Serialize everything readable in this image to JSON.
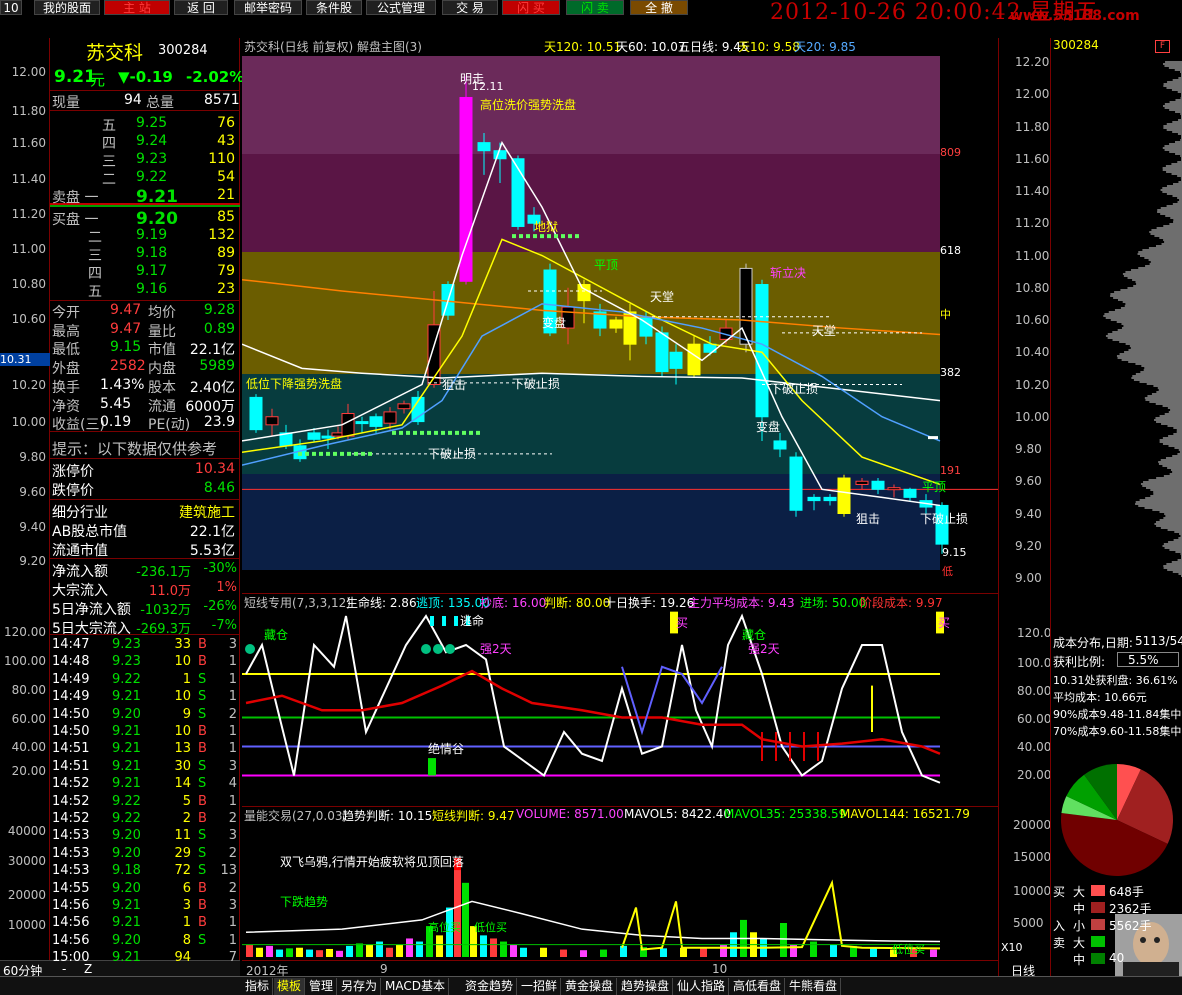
{
  "topbar": {
    "items": [
      "10",
      "我的股面",
      "主 站",
      "返 回",
      "邮举密码",
      "条件股",
      "公式管理",
      "交 易",
      "闪 买",
      "闪 卖",
      "全 撤"
    ],
    "clock": "2012-10-26 20:00:42 星期五",
    "watermark": "www.55188.com"
  },
  "stock": {
    "name": "苏交科",
    "code": "300284",
    "price": "9.21",
    "unit": "元",
    "change": "▼-0.19",
    "pct": "-2.02%"
  },
  "quote": {
    "now_vol_label": "现量",
    "now_vol": "94",
    "total_vol_label": "总量",
    "total_vol": "8571",
    "asks": [
      {
        "l": "五",
        "p": "9.25",
        "v": "76"
      },
      {
        "l": "四",
        "p": "9.24",
        "v": "43"
      },
      {
        "l": "三",
        "p": "9.23",
        "v": "110"
      },
      {
        "l": "二",
        "p": "9.22",
        "v": "54"
      },
      {
        "l": "卖盘 一",
        "p": "9.21",
        "v": "21"
      }
    ],
    "bids": [
      {
        "l": "买盘 一",
        "p": "9.20",
        "v": "85"
      },
      {
        "l": "二",
        "p": "9.19",
        "v": "132"
      },
      {
        "l": "三",
        "p": "9.18",
        "v": "89"
      },
      {
        "l": "四",
        "p": "9.17",
        "v": "79"
      },
      {
        "l": "五",
        "p": "9.16",
        "v": "23"
      }
    ],
    "stats": [
      [
        "今开",
        "9.47",
        "均价",
        "9.28"
      ],
      [
        "最高",
        "9.47",
        "量比",
        "0.89"
      ],
      [
        "最低",
        "9.15",
        "市值",
        "22.1亿"
      ],
      [
        "外盘",
        "2582",
        "内盘",
        "5989"
      ],
      [
        "换手",
        "1.43%",
        "股本",
        "2.40亿"
      ],
      [
        "净资",
        "5.45",
        "流通",
        "6000万"
      ],
      [
        "收益(三)",
        "0.19",
        "PE(动)",
        "23.9"
      ]
    ],
    "tip": "提示：以下数据仅供参考",
    "limits": [
      [
        "涨停价",
        "10.34"
      ],
      [
        "跌停价",
        "8.46"
      ]
    ],
    "industry": [
      [
        "细分行业",
        "建筑施工"
      ],
      [
        "AB股总市值",
        "22.1亿"
      ],
      [
        "流通市值",
        "5.53亿"
      ]
    ],
    "flows": [
      [
        "净流入额",
        "-236.1万",
        "-30%"
      ],
      [
        "大宗流入",
        "11.0万",
        "1%"
      ],
      [
        "5日净流入额",
        "-1032万",
        "-26%"
      ],
      [
        "5日大宗流入",
        "-269.3万",
        "-7%"
      ]
    ],
    "ticks": [
      [
        "14:47",
        "9.23",
        "33",
        "B",
        "3"
      ],
      [
        "14:48",
        "9.23",
        "10",
        "B",
        "1"
      ],
      [
        "14:49",
        "9.22",
        "1",
        "S",
        "1"
      ],
      [
        "14:49",
        "9.21",
        "10",
        "S",
        "1"
      ],
      [
        "14:50",
        "9.20",
        "9",
        "S",
        "2"
      ],
      [
        "14:50",
        "9.21",
        "10",
        "B",
        "1"
      ],
      [
        "14:51",
        "9.21",
        "13",
        "B",
        "1"
      ],
      [
        "14:51",
        "9.21",
        "30",
        "S",
        "3"
      ],
      [
        "14:52",
        "9.21",
        "14",
        "S",
        "4"
      ],
      [
        "14:52",
        "9.22",
        "5",
        "B",
        "1"
      ],
      [
        "14:52",
        "9.22",
        "2",
        "B",
        "2"
      ],
      [
        "14:53",
        "9.20",
        "11",
        "S",
        "3"
      ],
      [
        "14:53",
        "9.20",
        "29",
        "S",
        "2"
      ],
      [
        "14:53",
        "9.18",
        "72",
        "S",
        "13"
      ],
      [
        "14:55",
        "9.20",
        "6",
        "B",
        "2"
      ],
      [
        "14:56",
        "9.21",
        "3",
        "B",
        "3"
      ],
      [
        "14:56",
        "9.21",
        "1",
        "B",
        "1"
      ],
      [
        "14:56",
        "9.20",
        "8",
        "S",
        "1"
      ],
      [
        "15:00",
        "9.21",
        "94",
        "",
        "7"
      ]
    ],
    "period": "60分钟"
  },
  "leftaxis": {
    "price": [
      "12.00",
      "11.80",
      "11.60",
      "11.40",
      "11.20",
      "11.00",
      "10.80",
      "10.60",
      "10.40",
      "10.20",
      "10.00",
      "9.80",
      "9.60",
      "9.40",
      "9.20"
    ],
    "cur": "10.31",
    "ind": [
      "120.00",
      "100.00",
      "80.00",
      "60.00",
      "40.00",
      "20.00"
    ],
    "vol": [
      "40000",
      "30000",
      "20000",
      "10000"
    ]
  },
  "main": {
    "title": "苏交科(日线 前复权) 解盘主图(3)",
    "ma": [
      [
        "天120: 10.51",
        "#ffff00"
      ],
      [
        "天60: 10.07",
        "#fff"
      ],
      [
        "五日线: 9.45",
        "#fff"
      ],
      [
        "天10: 9.58",
        "#ffff00"
      ],
      [
        "天20: 9.85",
        "#5af"
      ]
    ],
    "labels": {
      "l12": "12.11",
      "hi": "明走",
      "wash": "高位洗价强势洗盘",
      "low": "低",
      "l915": "9.15",
      "tiankeng": "天堂",
      "pd1": "平顶",
      "pd2": "平顶",
      "xz": "斩立决",
      "biangpan": "变盘",
      "jj": "狙击",
      "xpz": "下破止损",
      "bianpan2": "变盘",
      "diyu": "地狱",
      "r809": "809",
      "r618": "618",
      "zhong": "中",
      "r382": "382",
      "r191": "191",
      "wash2": "低位下降强势洗盘"
    }
  },
  "rightaxis": {
    "price": [
      "12.20",
      "12.00",
      "11.80",
      "11.60",
      "11.40",
      "11.20",
      "11.00",
      "10.80",
      "10.60",
      "10.40",
      "10.20",
      "10.00",
      "9.80",
      "9.60",
      "9.40",
      "9.20",
      "9.00"
    ],
    "ind": [
      "120.0",
      "100.0",
      "80.00",
      "60.00",
      "40.00",
      "20.00"
    ],
    "vol": [
      "20000",
      "15000",
      "10000",
      "5000"
    ]
  },
  "ind1": {
    "title": "短线专用(7,3,3,12)",
    "items": [
      [
        "生命线: 2.86",
        "#fff"
      ],
      [
        "逃顶: 135.00",
        "#0ff"
      ],
      [
        "抄底: 16.00",
        "#f4f"
      ],
      [
        "判断: 80.00",
        "#ff0"
      ],
      [
        "十日换手: 19.26",
        "#fff"
      ],
      [
        "主力平均成本: 9.43",
        "#f4f"
      ],
      [
        "进场: 50.00",
        "#0f0"
      ],
      [
        "阶段成本: 9.97",
        "#f33"
      ]
    ],
    "labels": {
      "cang": "藏仓",
      "taoming": "逃命",
      "qiang": "强2天",
      "mai": "买",
      "cang2": "藏仓",
      "qiang2": "强2天",
      "mai2": "买",
      "jueqing": "绝情谷"
    }
  },
  "ind2": {
    "title": "量能交易(27,0.03)",
    "items": [
      [
        "趋势判断: 10.15",
        "#fff"
      ],
      [
        "短线判断: 9.47",
        "#ff0"
      ],
      [
        "VOLUME: 8571.00",
        "#f4f"
      ],
      [
        "MAVOL5: 8422.40",
        "#fff"
      ],
      [
        "MAVOL35: 25338.59",
        "#0f0"
      ],
      [
        "MAVOL144: 16521.79",
        "#ff0"
      ]
    ],
    "text": "双飞乌鸦,行情开始疲软将见顶回落",
    "down": "下跌趋势",
    "gaodi1": "高位买",
    "low1": "低位买",
    "x10": "X10"
  },
  "xaxis": {
    "year": "2012年",
    "m9": "9",
    "m10": "10"
  },
  "dist": {
    "code": "300284",
    "title": "成本分布,日期:",
    "date": "5113/54",
    "ratio_label": "获利比例:",
    "ratio": "5.5%",
    "l1": "10.31处获利盘: 36.61%",
    "l2": "平均成本: 10.66元",
    "l3": "90%成本9.48-11.84集中",
    "l4": "70%成本9.60-11.58集中",
    "legend": [
      [
        "买",
        "大",
        "648手",
        "#ff5050"
      ],
      [
        "",
        "中",
        "2362手",
        "#a02020"
      ],
      [
        "入",
        "小",
        "5562手",
        "#c04040"
      ],
      [
        "卖",
        "大",
        "",
        "#00c000"
      ],
      [
        "",
        "中",
        "40",
        "#008000"
      ]
    ],
    "period": "日线"
  },
  "bottom": {
    "tabs": [
      "指标",
      "模板",
      "管理",
      "另存为",
      "MACD基本",
      "资金趋势",
      "一招鲜",
      "黄金操盘",
      "趋势操盘",
      "仙人指路",
      "高低看盘",
      "牛熊看盘"
    ],
    "active": 1,
    "left": [
      "60分钟",
      "-",
      "Z"
    ]
  },
  "colors": {
    "up": "#00ffff",
    "down": "#ff3c3c",
    "bg": "#000"
  }
}
